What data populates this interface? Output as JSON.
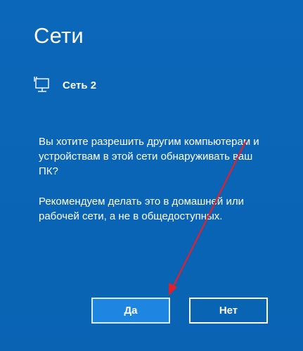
{
  "dialog": {
    "title": "Сети",
    "network_name": "Сеть 2",
    "network_icon": "wired-network-icon",
    "question": "Вы хотите разрешить другим компьютерам и устройствам в этой сети обнаруживать ваш ПК?",
    "recommendation": "Рекомендуем делать это в домашней или рабочей сети, а не в общедоступных."
  },
  "buttons": {
    "yes_label": "Да",
    "no_label": "Нет"
  },
  "colors": {
    "background": "#0a66b8",
    "yes_button": "#1e86e0",
    "annotation_arrow": "#e0202a"
  }
}
